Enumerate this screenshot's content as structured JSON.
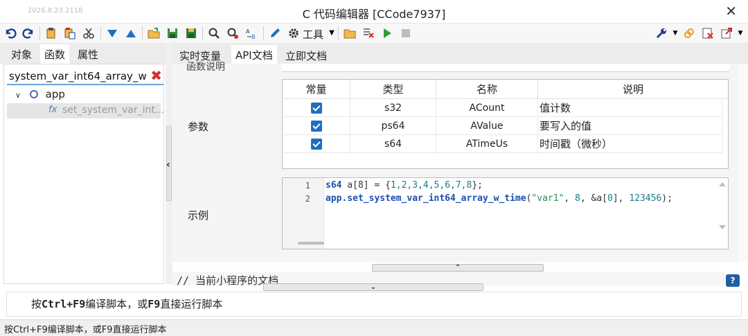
{
  "window": {
    "timestamp": "2026.8.23.2118",
    "title": "C 代码编辑器 [CCode7937]",
    "close_glyph": "✕"
  },
  "toolbar": {
    "tools_label": "工具",
    "icons": [
      "undo-icon",
      "redo-icon",
      "copy-icon",
      "paste-icon",
      "cut-icon",
      "move-down-icon",
      "move-up-icon",
      "open-folder-icon",
      "save-icon",
      "save-as-icon",
      "search-icon",
      "find-replace-icon",
      "replace-icon",
      "edit-icon",
      "gear-icon",
      "folder-icon",
      "clear-icon",
      "run-icon",
      "stop-icon",
      "wrench-icon",
      "link-icon",
      "close-doc-icon",
      "export-icon"
    ],
    "accent_green": "#2e9e3a",
    "accent_blue": "#1e6fc2"
  },
  "left_panel": {
    "tabs": [
      "对象",
      "函数",
      "属性"
    ],
    "active_tab": "函数",
    "search_value": "system_var_int64_array_w",
    "clear_glyph": "✖",
    "tree": {
      "root": "app",
      "child": "set_system_var_int..."
    }
  },
  "right_panel": {
    "tabs": [
      "实时变量",
      "API文档",
      "立即文档"
    ],
    "active_tab": "API文档",
    "partial_label": "函数说明",
    "params_label": "参数",
    "example_label": "示例",
    "param_table": {
      "headers": [
        "常量",
        "类型",
        "名称",
        "说明"
      ],
      "rows": [
        {
          "const": true,
          "type": "s32",
          "name": "ACount",
          "desc": "值计数"
        },
        {
          "const": true,
          "type": "ps64",
          "name": "AValue",
          "desc": "要写入的值"
        },
        {
          "const": true,
          "type": "s64",
          "name": "ATimeUs",
          "desc": "时间戳（微秒）"
        }
      ]
    },
    "code": {
      "line_numbers": [
        "1",
        "2"
      ],
      "line1": {
        "kw": "s64",
        "rest": " a[8] = {",
        "nums": "1,2,3,4,5,6,7,8",
        "end": "};"
      },
      "line2": {
        "obj": "app.set_system_var_int64_array_w_time",
        "open": "(",
        "str": "\"var1\"",
        "mid": ", ",
        "n1": "8",
        "mid2": ", &a[",
        "n2": "0",
        "mid3": "], ",
        "n3": "123456",
        "end": ");"
      }
    }
  },
  "doc_line": "// 当前小程序的文档",
  "help_glyph": "?",
  "output": {
    "prefix": "按",
    "key1": "Ctrl+F9",
    "middle": "编译脚本，或",
    "key2": "F9",
    "suffix": "直接运行脚本"
  },
  "status_text": "按Ctrl+F9编译脚本，或F9直接运行脚本"
}
